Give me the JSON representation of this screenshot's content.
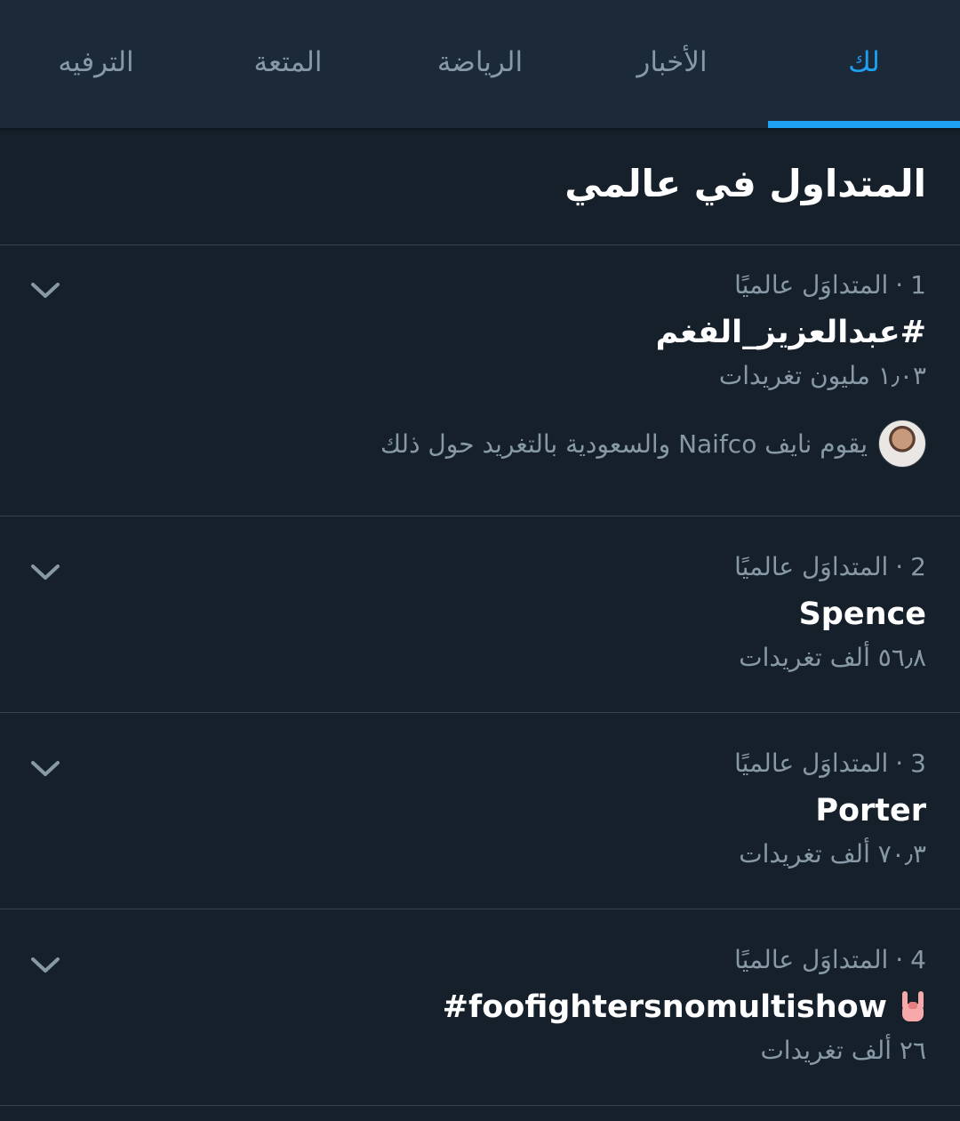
{
  "tabs": [
    {
      "label": "لك",
      "active": true
    },
    {
      "label": "الأخبار",
      "active": false
    },
    {
      "label": "الرياضة",
      "active": false
    },
    {
      "label": "المتعة",
      "active": false
    },
    {
      "label": "الترفيه",
      "active": false
    }
  ],
  "section_title": "المتداول في عالمي",
  "trends": [
    {
      "rank": "1",
      "category": "المتداوَل عالميًا",
      "name": "#عبدالعزيز_الفغم",
      "count": "١٫٠٣ مليون تغريدات",
      "context": "يقوم نايف Naifco والسعودية بالتغريد حول ذلك",
      "menu_icon": "chevron-down-icon"
    },
    {
      "rank": "2",
      "category": "المتداوَل عالميًا",
      "name": "Spence",
      "count": "٥٦٫٨ ألف تغريدات",
      "menu_icon": "chevron-down-icon"
    },
    {
      "rank": "3",
      "category": "المتداوَل عالميًا",
      "name": "Porter",
      "count": "٧٠٫٣ ألف تغريدات",
      "menu_icon": "chevron-down-icon"
    },
    {
      "rank": "4",
      "category": "المتداوَل عالميًا",
      "name": "#foofightersnomultishow",
      "count": "٢٦ ألف تغريدات",
      "emoji": "sign-of-the-horns-icon",
      "menu_icon": "chevron-down-icon"
    }
  ],
  "colors": {
    "background": "#15202b",
    "tab_bar": "#1c2938",
    "accent": "#1da1f2",
    "secondary_text": "#8899a6",
    "divider": "#38444d"
  }
}
